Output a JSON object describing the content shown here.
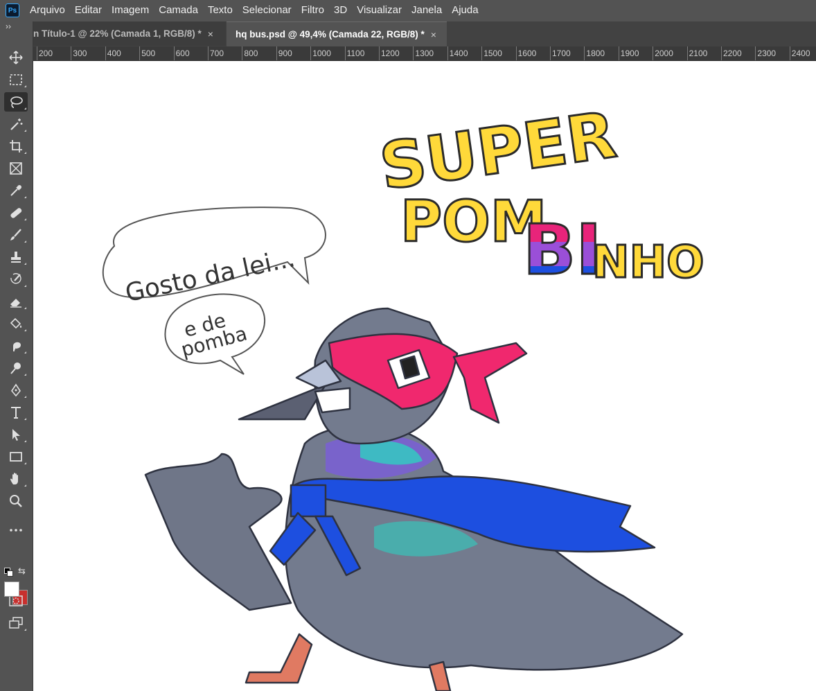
{
  "app": {
    "logo": "Ps"
  },
  "menu": [
    "Arquivo",
    "Editar",
    "Imagem",
    "Camada",
    "Texto",
    "Selecionar",
    "Filtro",
    "3D",
    "Visualizar",
    "Janela",
    "Ajuda"
  ],
  "tabs": [
    {
      "label": "n Título-1 @ 22% (Camada 1, RGB/8) *",
      "close": "×",
      "active": false
    },
    {
      "label": "hq bus.psd @ 49,4% (Camada 22, RGB/8) *",
      "close": "×",
      "active": true
    }
  ],
  "toolbar": {
    "collapse": "››",
    "tools": [
      "move-tool",
      "marquee-tool",
      "lasso-tool",
      "magic-wand-tool",
      "crop-tool",
      "frame-tool",
      "eyedropper-tool",
      "healing-brush-tool",
      "brush-tool",
      "clone-stamp-tool",
      "history-brush-tool",
      "eraser-tool",
      "paint-bucket-tool",
      "smudge-tool",
      "dodge-tool",
      "pen-tool",
      "type-tool",
      "path-selection-tool",
      "rectangle-tool",
      "hand-tool",
      "zoom-tool",
      "more-tools"
    ],
    "selected": "lasso-tool",
    "foreground_color": "#ffffff",
    "background_color": "#c8302e"
  },
  "ruler": {
    "labels": [
      "200",
      "300",
      "400",
      "500",
      "600",
      "700",
      "800",
      "900",
      "1000",
      "1100",
      "1200",
      "1300",
      "1400",
      "1500",
      "1600",
      "1700",
      "1800",
      "1900",
      "2000",
      "2100",
      "2200",
      "2300",
      "2400"
    ]
  },
  "artwork": {
    "title_line1": "SUPER",
    "title_line2_a": "POM",
    "title_line2_b": "BI",
    "title_line2_c": "NHO",
    "bubble1": "Gosto da lei...",
    "bubble2_line1": "e de",
    "bubble2_line2": "pomba",
    "colors": {
      "title_yellow": "#ffd93a",
      "mask_pink": "#f0286e",
      "cape_blue": "#1d4fe0",
      "pigeon_gray": "#737b8e",
      "bi_purple": "#9a4fd8"
    }
  }
}
